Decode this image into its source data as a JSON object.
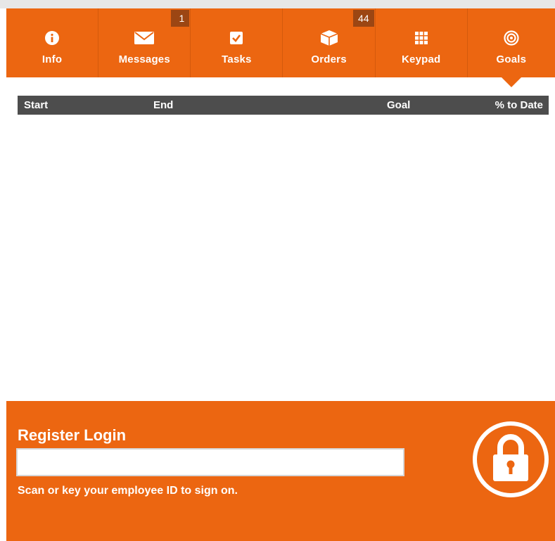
{
  "tabs": [
    {
      "name": "info",
      "label": "Info",
      "icon": "info-icon",
      "badge": null
    },
    {
      "name": "messages",
      "label": "Messages",
      "icon": "envelope-icon",
      "badge": "1"
    },
    {
      "name": "tasks",
      "label": "Tasks",
      "icon": "checkbox-icon",
      "badge": null
    },
    {
      "name": "orders",
      "label": "Orders",
      "icon": "box-icon",
      "badge": "44"
    },
    {
      "name": "keypad",
      "label": "Keypad",
      "icon": "keypad-icon",
      "badge": null
    },
    {
      "name": "goals",
      "label": "Goals",
      "icon": "target-icon",
      "badge": null,
      "active": true
    }
  ],
  "goals_table": {
    "columns": [
      "Start",
      "End",
      "Goal",
      "% to Date"
    ],
    "rows": []
  },
  "login": {
    "title": "Register Login",
    "input_value": "",
    "hint": "Scan or key your employee ID to sign on.",
    "icon": "lock-icon"
  },
  "colors": {
    "accent": "#ec6611",
    "badge": "#9c4613",
    "table_header": "#4d4d4d"
  }
}
